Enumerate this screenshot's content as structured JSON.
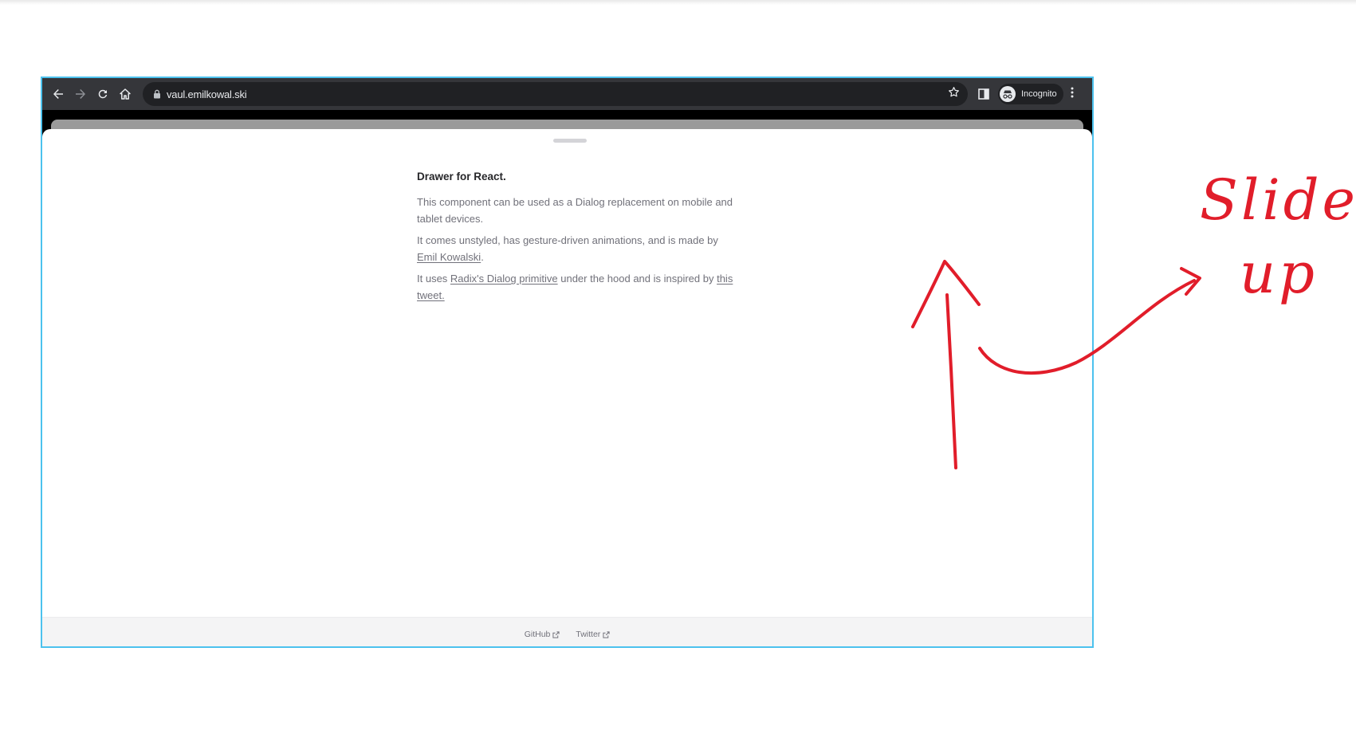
{
  "browser": {
    "url": "vaul.emilkowal.ski",
    "profile_label": "Incognito",
    "icons": [
      "back-arrow-icon",
      "forward-arrow-icon",
      "reload-icon",
      "home-icon",
      "lock-icon",
      "star-icon",
      "side-panel-icon",
      "incognito-icon",
      "kebab-menu-icon"
    ]
  },
  "drawer": {
    "title": "Drawer for React.",
    "p1": "This component can be used as a Dialog replacement on mobile and tablet devices.",
    "p2_before": "It comes unstyled, has gesture-driven animations, and is made by ",
    "p2_link": "Emil Kowalski",
    "p2_after": ".",
    "p3_before": "It uses ",
    "p3_link1": "Radix's Dialog primitive",
    "p3_middle": " under the hood and is inspired by ",
    "p3_link2": "this tweet."
  },
  "footer": {
    "github": "GitHub",
    "twitter": "Twitter"
  },
  "annotation": {
    "line1": "Slides",
    "line2": "up",
    "color": "#e11d2a"
  },
  "colors": {
    "frame_border": "#4cc2ee",
    "toolbar_bg": "#35363a",
    "omnibox_bg": "#202124"
  }
}
